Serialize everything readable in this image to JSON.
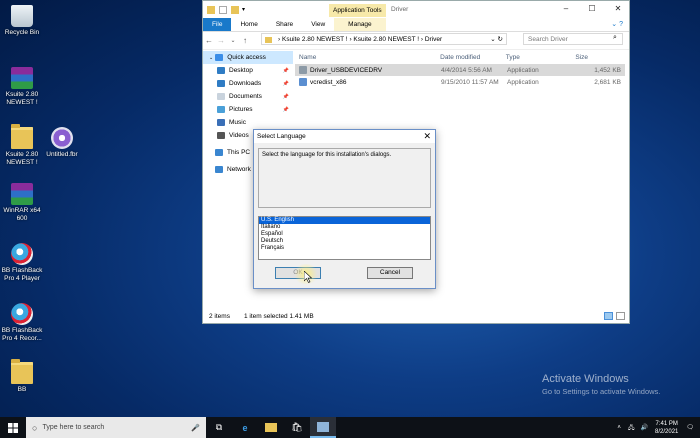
{
  "desktop": {
    "icons": [
      {
        "label": "Recycle Bin"
      },
      {
        "label": "Ksuite 2.80 NEWEST !"
      },
      {
        "label": "Ksuite 2.80 NEWEST !"
      },
      {
        "label": "Untitled.fbr"
      },
      {
        "label": "WinRAR x64 600"
      },
      {
        "label": "BB FlashBack Pro 4 Player"
      },
      {
        "label": "BB FlashBack Pro 4 Recor..."
      },
      {
        "label": "BB"
      }
    ]
  },
  "explorer": {
    "app_tools": "Application Tools",
    "title": "Driver",
    "tabs": [
      "File",
      "Home",
      "Share",
      "View",
      "Manage"
    ],
    "breadcrumb": [
      "Ksuite 2.80 NEWEST !",
      "Ksuite 2.80 NEWEST !",
      "Driver"
    ],
    "search_placeholder": "Search Driver",
    "nav": [
      "Quick access",
      "Desktop",
      "Downloads",
      "Documents",
      "Pictures",
      "Music",
      "Videos",
      "This PC",
      "Network"
    ],
    "columns": [
      "Name",
      "Date modified",
      "Type",
      "Size"
    ],
    "files": [
      {
        "name": "Driver_USBDEVICEDRV",
        "date": "4/4/2014 5:56 AM",
        "type": "Application",
        "size": "1,452 KB"
      },
      {
        "name": "vcredist_x86",
        "date": "9/15/2010 11:57 AM",
        "type": "Application",
        "size": "2,681 KB"
      }
    ],
    "status_items": "2 items",
    "status_selected": "1 item selected  1.41 MB"
  },
  "dialog": {
    "title": "Select Language",
    "prompt": "Select the language for this installation's dialogs.",
    "languages": [
      "U.S. English",
      "Italiano",
      "Español",
      "Deutsch",
      "Français"
    ],
    "selected": "U.S. English",
    "ok": "OK",
    "cancel": "Cancel"
  },
  "watermark": {
    "line1": "Activate Windows",
    "line2": "Go to Settings to activate Windows."
  },
  "taskbar": {
    "search_placeholder": "Type here to search",
    "time": "7:41 PM",
    "date": "8/2/2021"
  }
}
